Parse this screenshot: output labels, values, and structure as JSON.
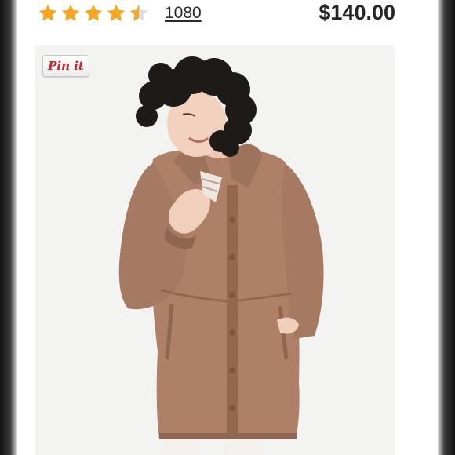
{
  "product": {
    "rating": 4.5,
    "review_count": "1080",
    "price": "$140.00",
    "stars": [
      "star-icon-full",
      "star-icon-full",
      "star-icon-full",
      "star-icon-full",
      "star-icon-half"
    ]
  },
  "pinterest": {
    "label": "Pin it"
  },
  "colors": {
    "star": "#f5a623",
    "star_empty": "#d9d9d9",
    "pin_red": "#c8232c",
    "coat": "#ae8068",
    "photo_bg": "#f3f3f1"
  }
}
